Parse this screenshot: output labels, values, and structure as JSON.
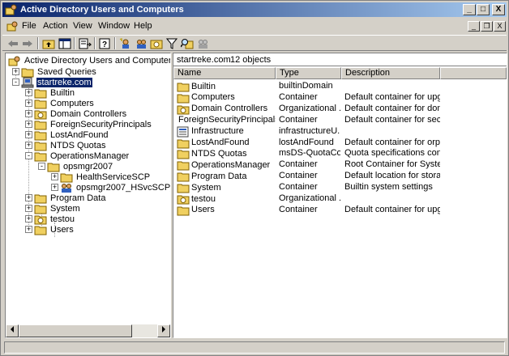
{
  "window": {
    "title": "Active Directory Users and Computers"
  },
  "caption_buttons": {
    "minimize": "_",
    "maximize": "□",
    "close": "X"
  },
  "menubar": {
    "items": [
      {
        "label": "File"
      },
      {
        "label": "Action"
      },
      {
        "label": "View"
      },
      {
        "label": "Window"
      },
      {
        "label": "Help"
      }
    ],
    "mdi": {
      "minimize": "_",
      "restore": "❐",
      "close": "X"
    }
  },
  "toolbar": {
    "icons": [
      "back-icon",
      "forward-icon",
      "up-folder-icon",
      "show-hide-tree-icon",
      "export-list-icon",
      "help-icon",
      "new-user-icon",
      "new-group-icon",
      "new-ou-icon",
      "filter-icon",
      "find-icon",
      "add-to-group-icon"
    ]
  },
  "tree": {
    "root": "Active Directory Users and Computers [stevera",
    "items": [
      {
        "label": "Saved Queries",
        "icon": "folder",
        "level": 1,
        "expander": "+"
      },
      {
        "label": "startreke.com",
        "icon": "domain",
        "level": 1,
        "expander": "-",
        "selected": true
      },
      {
        "label": "Builtin",
        "icon": "folder",
        "level": 2,
        "expander": "+"
      },
      {
        "label": "Computers",
        "icon": "folder",
        "level": 2,
        "expander": "+"
      },
      {
        "label": "Domain Controllers",
        "icon": "ou",
        "level": 2,
        "expander": "+"
      },
      {
        "label": "ForeignSecurityPrincipals",
        "icon": "folder",
        "level": 2,
        "expander": "+"
      },
      {
        "label": "LostAndFound",
        "icon": "folder",
        "level": 2,
        "expander": "+"
      },
      {
        "label": "NTDS Quotas",
        "icon": "folder",
        "level": 2,
        "expander": "+"
      },
      {
        "label": "OperationsManager",
        "icon": "folder",
        "level": 2,
        "expander": "-"
      },
      {
        "label": "opsmgr2007",
        "icon": "folder",
        "level": 3,
        "expander": "-"
      },
      {
        "label": "HealthServiceSCP",
        "icon": "folder",
        "level": 4,
        "expander": "+"
      },
      {
        "label": "opsmgr2007_HSvcSCP_SG",
        "icon": "group",
        "level": 4,
        "expander": "+"
      },
      {
        "label": "Program Data",
        "icon": "folder",
        "level": 2,
        "expander": "+"
      },
      {
        "label": "System",
        "icon": "folder",
        "level": 2,
        "expander": "+"
      },
      {
        "label": "testou",
        "icon": "ou",
        "level": 2,
        "expander": "+"
      },
      {
        "label": "Users",
        "icon": "folder",
        "level": 2,
        "expander": "+"
      }
    ]
  },
  "list": {
    "domain": "startreke.com",
    "count": "12 objects",
    "columns": [
      "Name",
      "Type",
      "Description"
    ],
    "rows": [
      {
        "name": "Builtin",
        "type": "builtinDomain",
        "description": "",
        "icon": "folder"
      },
      {
        "name": "Computers",
        "type": "Container",
        "description": "Default container for upgr...",
        "icon": "folder"
      },
      {
        "name": "Domain Controllers",
        "type": "Organizational ...",
        "description": "Default container for dom...",
        "icon": "ou"
      },
      {
        "name": "ForeignSecurityPrincipals",
        "type": "Container",
        "description": "Default container for secu...",
        "icon": "folder"
      },
      {
        "name": "Infrastructure",
        "type": "infrastructureU...",
        "description": "",
        "icon": "infra"
      },
      {
        "name": "LostAndFound",
        "type": "lostAndFound",
        "description": "Default container for orph...",
        "icon": "folder"
      },
      {
        "name": "NTDS Quotas",
        "type": "msDS-QuotaCo...",
        "description": "Quota specifications cont...",
        "icon": "folder"
      },
      {
        "name": "OperationsManager",
        "type": "Container",
        "description": "Root Container for Syste...",
        "icon": "folder"
      },
      {
        "name": "Program Data",
        "type": "Container",
        "description": "Default location for storag...",
        "icon": "folder"
      },
      {
        "name": "System",
        "type": "Container",
        "description": "Builtin system settings",
        "icon": "folder"
      },
      {
        "name": "testou",
        "type": "Organizational ...",
        "description": "",
        "icon": "ou"
      },
      {
        "name": "Users",
        "type": "Container",
        "description": "Default container for upgr...",
        "icon": "folder"
      }
    ]
  },
  "colors": {
    "title_start": "#0a246a",
    "title_end": "#a6caf0",
    "selection": "#0a246a",
    "folder": "#f0d060"
  }
}
